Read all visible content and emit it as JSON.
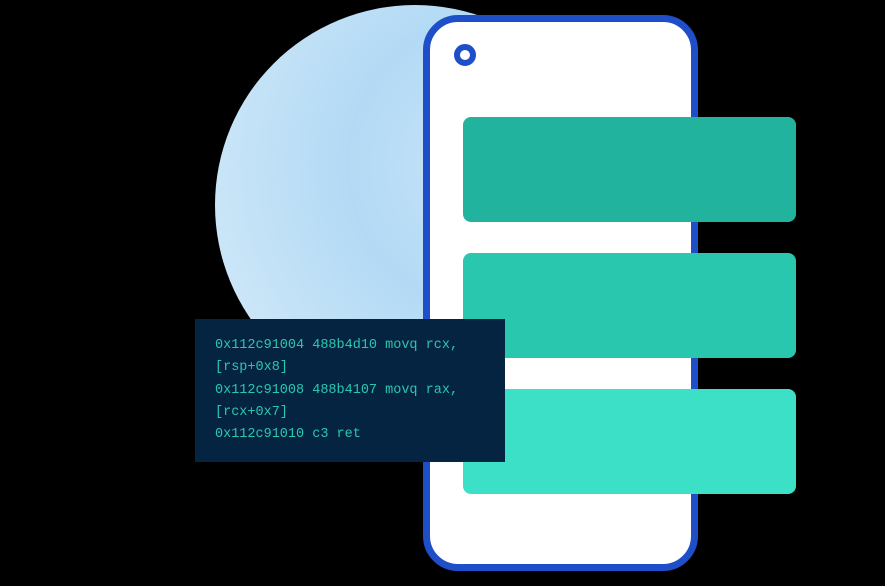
{
  "code": {
    "line1": "0x112c91004 488b4d10 movq rcx,",
    "line2": "[rsp+0x8]",
    "line3": "0x112c91008 488b4107 movq rax,",
    "line4": "[rcx+0x7]",
    "line5": "0x112c91010 c3 ret"
  }
}
